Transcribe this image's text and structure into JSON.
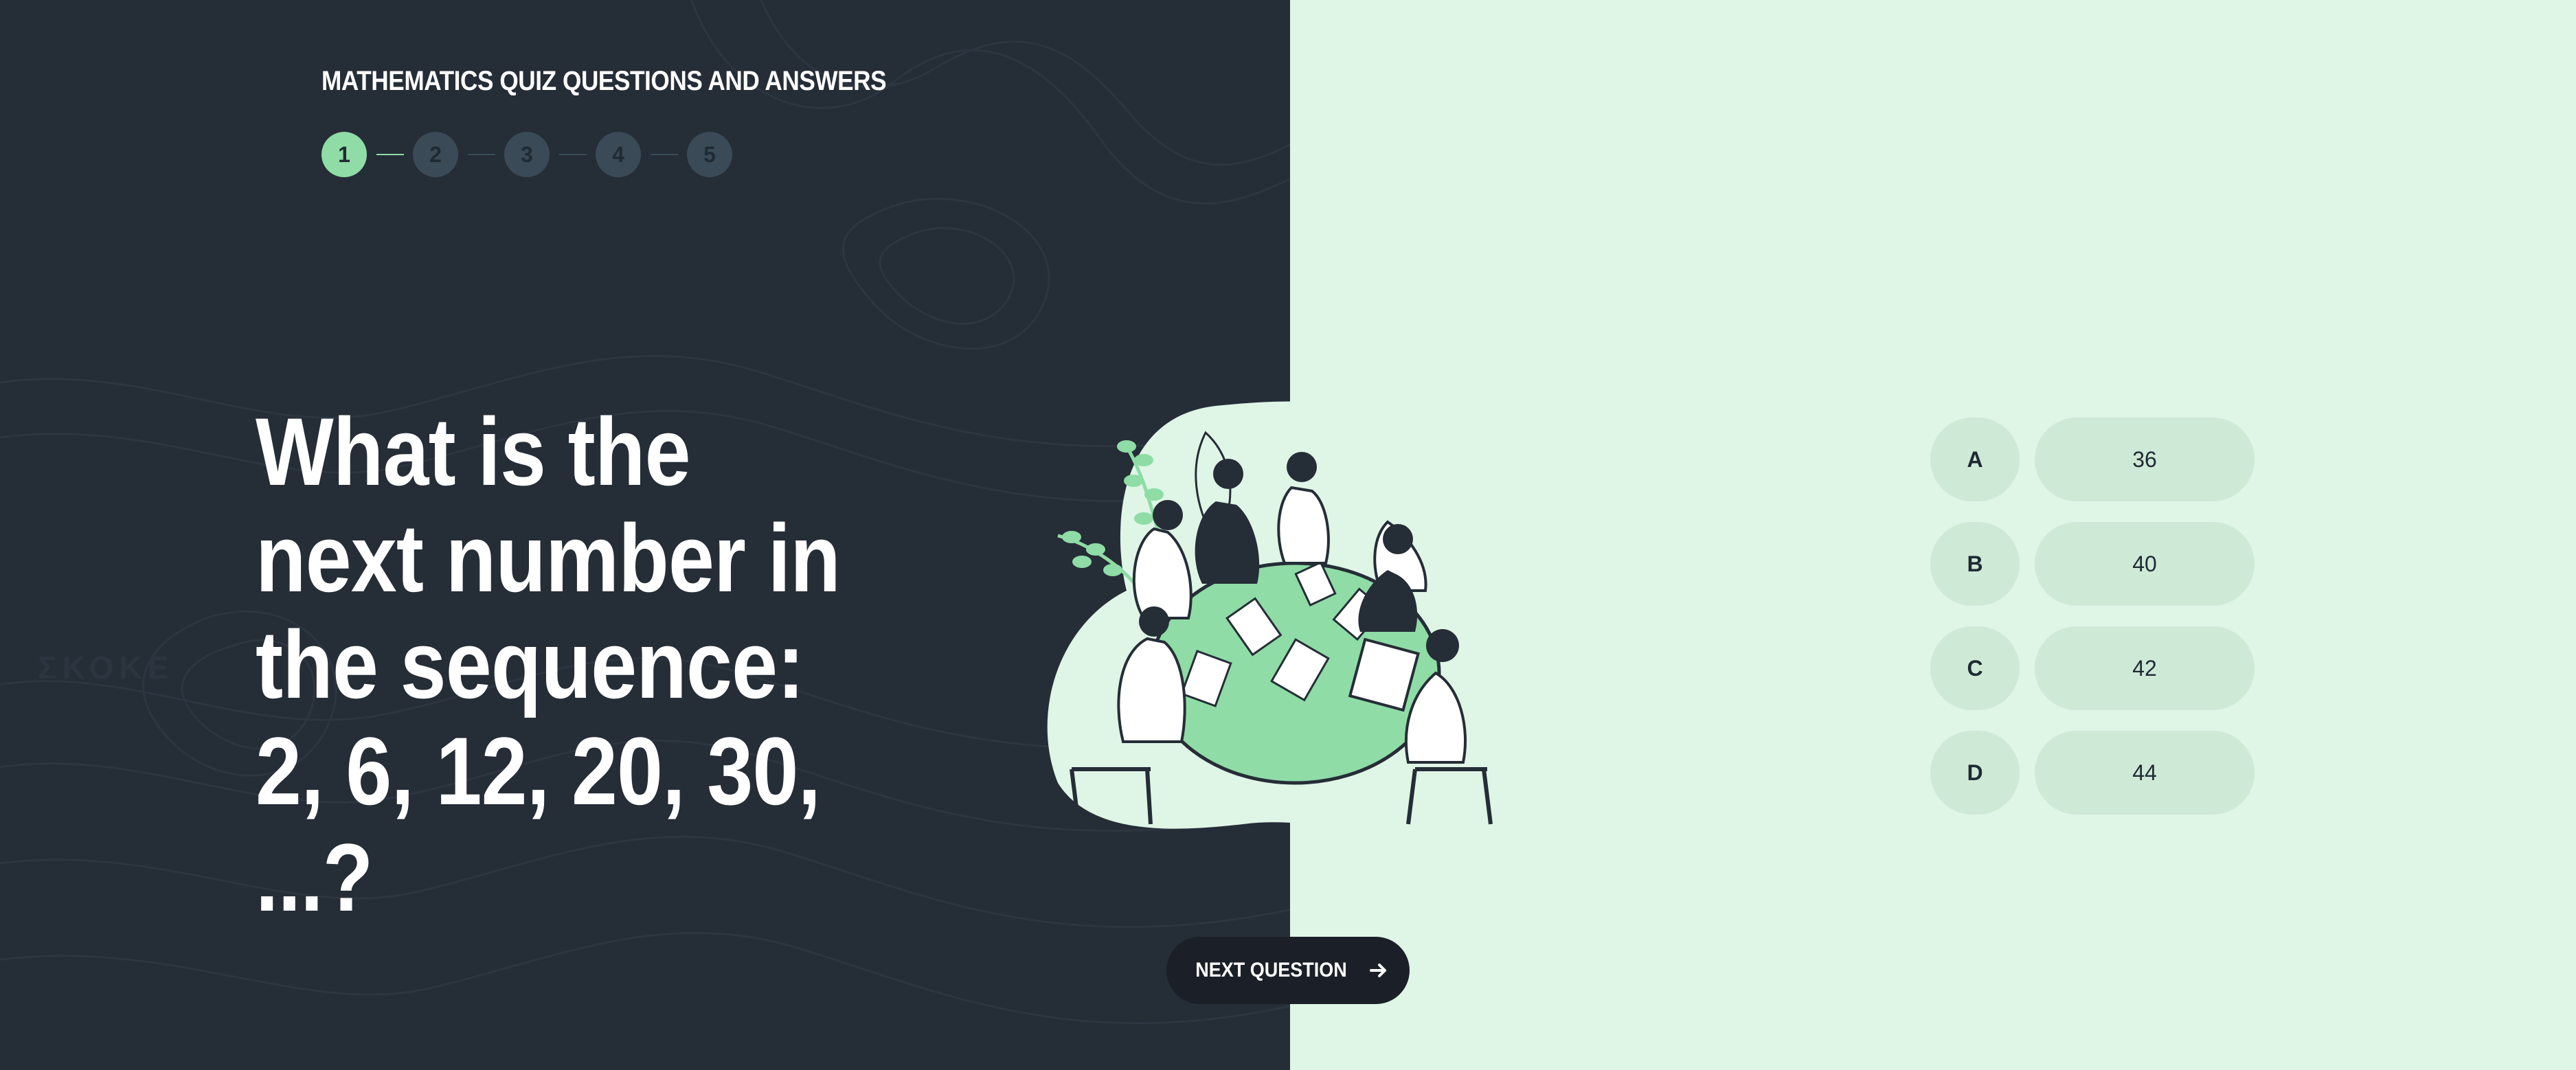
{
  "quiz": {
    "title": "MATHEMATICS QUIZ QUESTIONS AND ANSWERS",
    "steps": [
      "1",
      "2",
      "3",
      "4",
      "5"
    ],
    "current_step": 1,
    "question": "What is the next number in the sequence: 2, 6, 12, 20, 30, ...?",
    "answers": [
      {
        "letter": "A",
        "value": "36"
      },
      {
        "letter": "B",
        "value": "40"
      },
      {
        "letter": "C",
        "value": "42"
      },
      {
        "letter": "D",
        "value": "44"
      }
    ],
    "next_button": {
      "label": "NEXT QUESTION",
      "icon": "arrow-right-icon"
    }
  },
  "colors": {
    "dark_panel": "#252d37",
    "light_panel": "#dff5e6",
    "accent": "#8fdca6",
    "step_inactive": "#3a4b57",
    "answer_pill": "#cfe9d7",
    "button": "#1b2028"
  },
  "illustration": {
    "icon": "team-meeting-illustration"
  }
}
